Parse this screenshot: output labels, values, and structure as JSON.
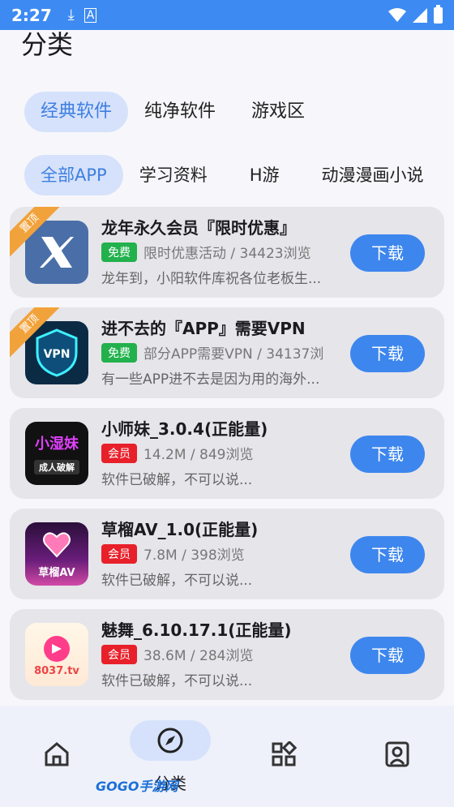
{
  "status_bar": {
    "time": "2:27",
    "icons": [
      "download-icon",
      "a-icon",
      "wifi-icon",
      "signal-icon",
      "battery-icon"
    ]
  },
  "page_title": "分类",
  "category_tabs": [
    {
      "label": "经典软件",
      "active": true
    },
    {
      "label": "纯净软件",
      "active": false
    },
    {
      "label": "游戏区",
      "active": false
    }
  ],
  "sub_tabs": [
    {
      "label": "全部APP",
      "active": true
    },
    {
      "label": "学习资料",
      "active": false
    },
    {
      "label": "H游",
      "active": false
    },
    {
      "label": "动漫漫画小说",
      "active": false
    }
  ],
  "apps": [
    {
      "pinned": true,
      "ribbon": "置顶",
      "icon": "x-logo-icon",
      "title": "龙年永久会员『限时优惠』",
      "badge": "免费",
      "meta": "限时优惠活动 / 34423浏览",
      "desc": "龙年到，小阳软件库祝各位老板生...",
      "button": "下载"
    },
    {
      "pinned": true,
      "ribbon": "置顶",
      "icon": "vpn-shield-icon",
      "title": "进不去的『APP』需要VPN",
      "badge": "免费",
      "meta": "部分APP需要VPN / 34137浏",
      "desc": "有一些APP进不去是因为用的海外...",
      "button": "下载"
    },
    {
      "pinned": false,
      "icon": "xiaoshimei-app-icon",
      "icon_text": "小湿妹",
      "icon_sub": "成人破解",
      "title": "小师妹_3.0.4(正能量)",
      "badge": "会员",
      "meta": "14.2M / 849浏览",
      "desc": "软件已破解，不可以说...",
      "button": "下载"
    },
    {
      "pinned": false,
      "icon": "caoliu-app-icon",
      "icon_text": "草榴AV",
      "title": "草榴AV_1.0(正能量)",
      "badge": "会员",
      "meta": "7.8M / 398浏览",
      "desc": "软件已破解，不可以说...",
      "button": "下载"
    },
    {
      "pinned": false,
      "icon": "meiwu-app-icon",
      "icon_text": "8037.tv",
      "title": "魅舞_6.10.17.1(正能量)",
      "badge": "会员",
      "meta": "38.6M / 284浏览",
      "desc": "软件已破解，不可以说...",
      "button": "下载"
    }
  ],
  "bottom_nav": {
    "items": [
      {
        "name": "home",
        "icon": "home-icon"
      },
      {
        "name": "category",
        "icon": "compass-icon",
        "label": "分类",
        "active": true
      },
      {
        "name": "apps",
        "icon": "grid-icon"
      },
      {
        "name": "profile",
        "icon": "user-icon"
      }
    ]
  },
  "watermark": "GOGO手游网",
  "colors": {
    "primary": "#3d86ee",
    "status_bar": "#3d8bf2",
    "free_badge": "#22b14c",
    "vip_badge": "#e8202a",
    "ribbon": "#f2a23a"
  }
}
